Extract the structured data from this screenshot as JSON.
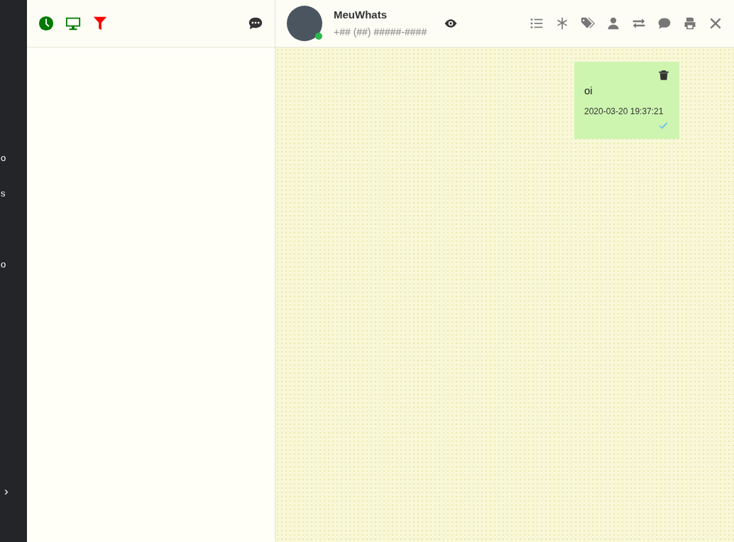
{
  "sidebar": {
    "items": [
      {
        "label": "o"
      },
      {
        "label": "s"
      },
      {
        "label": "o"
      }
    ],
    "expand_label": "›"
  },
  "left_toolbar": {
    "icons": [
      {
        "kind": "clock",
        "color": "#007a00"
      },
      {
        "kind": "monitor",
        "color": "#007a00"
      },
      {
        "kind": "filter",
        "color": "#ff0000"
      }
    ]
  },
  "contact": {
    "name": "MeuWhats",
    "phone": "+## (##) #####-####",
    "online": true
  },
  "header_actions": [
    {
      "kind": "list"
    },
    {
      "kind": "asterisk"
    },
    {
      "kind": "tags"
    },
    {
      "kind": "user"
    },
    {
      "kind": "exchange"
    },
    {
      "kind": "comment"
    },
    {
      "kind": "print"
    },
    {
      "kind": "close"
    }
  ],
  "messages": [
    {
      "text": "oi",
      "time": "2020-03-20 19:37:21",
      "read": true
    }
  ]
}
